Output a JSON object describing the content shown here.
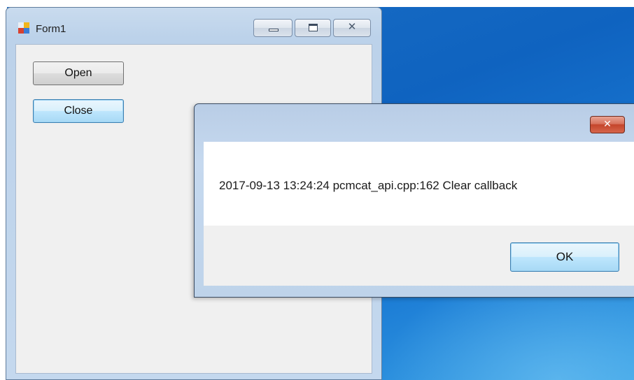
{
  "form1": {
    "title": "Form1",
    "buttons": {
      "open_label": "Open",
      "close_label": "Close"
    },
    "caption_icons": [
      "minimize-icon",
      "maximize-icon",
      "close-icon"
    ]
  },
  "message_box": {
    "message": "2017-09-13 13:24:24 pcmcat_api.cpp:162 Clear callback",
    "ok_label": "OK",
    "close_glyph": "✕"
  },
  "colors": {
    "desktop": "#0f63c0",
    "dialog_close": "#c4452b",
    "focused_button": "#3c7fb1"
  }
}
